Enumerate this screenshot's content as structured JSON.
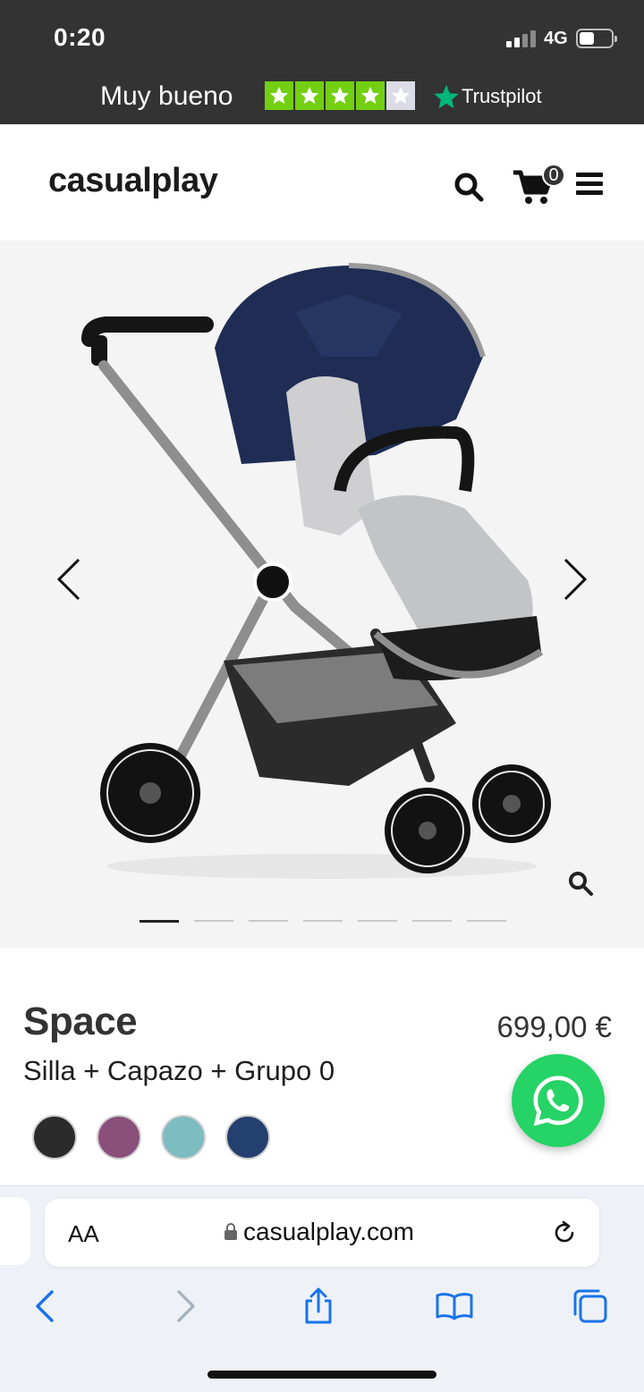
{
  "status_bar": {
    "time": "0:20",
    "network": "4G",
    "icons": [
      "signal-icon",
      "battery-icon"
    ]
  },
  "trustpilot": {
    "rating_text": "Muy bueno",
    "stars": 4,
    "stars_total": 5,
    "brand": "Trustpilot",
    "star_color": "#73cf11",
    "brand_star_color": "#00b67a"
  },
  "header": {
    "logo": "casualplay",
    "cart_count": "0",
    "icons": [
      "search-icon",
      "cart-icon",
      "menu-icon"
    ]
  },
  "gallery": {
    "image": "stroller-photo",
    "slide_count": 7,
    "active_slide": 1,
    "icons": [
      "chevron-left-icon",
      "chevron-right-icon",
      "zoom-icon"
    ]
  },
  "product": {
    "title": "Space",
    "subtitle": "Silla + Capazo + Grupo 0",
    "price": "699,00 €",
    "colors": [
      "#2b2b2b",
      "#8a4f7b",
      "#7dbcc0",
      "#24406e"
    ]
  },
  "whatsapp": {
    "icon": "whatsapp-icon",
    "color": "#25d366"
  },
  "browser": {
    "aa_label": "AA",
    "url": "casualplay.com",
    "icons": [
      "lock-icon",
      "reload-icon",
      "back-icon",
      "forward-icon",
      "share-icon",
      "bookmarks-icon",
      "tabs-icon"
    ],
    "accent": "#1a73e8"
  }
}
